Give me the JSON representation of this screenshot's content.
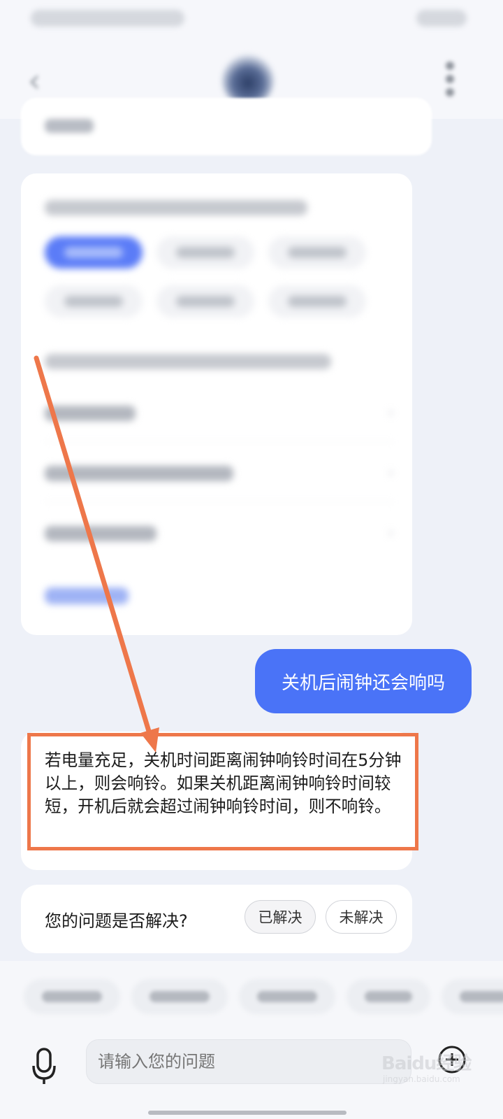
{
  "chat": {
    "user_message": "关机后闹钟还会响吗",
    "answer_text": "若电量充足，关机时间距离闹钟响铃时间在5分钟以上，则会响铃。如果关机距离闹钟响铃时间较短，开机后就会超过闹钟响铃时间，则不响铃。"
  },
  "feedback": {
    "question": "您的问题是否解决?",
    "resolved_label": "已解决",
    "unresolved_label": "未解决"
  },
  "input": {
    "placeholder": "请输入您的问题"
  },
  "watermark": {
    "text": "Baidu经验",
    "sub": "jingyan.baidu.com"
  },
  "colors": {
    "accent": "#4a73f7",
    "annotation": "#ee774a"
  }
}
